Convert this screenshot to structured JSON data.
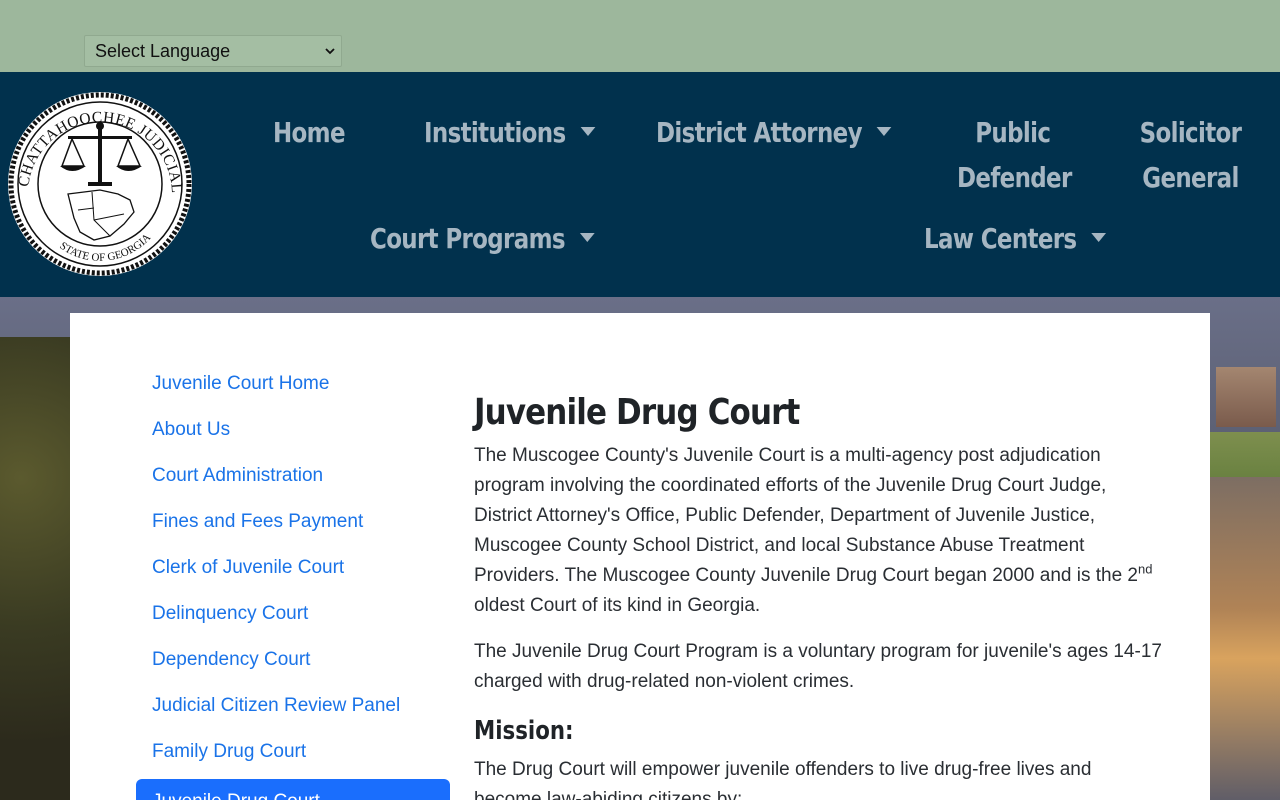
{
  "language": {
    "selected": "Select Language"
  },
  "nav": {
    "items": [
      {
        "label": "Home"
      },
      {
        "label": "Institutions"
      },
      {
        "label": "District Attorney"
      },
      {
        "label": "Public Defender"
      },
      {
        "label": "Solicitor General"
      },
      {
        "label": "Court Programs"
      },
      {
        "label": "Law Centers"
      }
    ]
  },
  "seal": {
    "outer_text": "CHATTAHOOCHEE JUDICIAL CIRCUIT",
    "inner_text": "STATE OF GEORGIA"
  },
  "sidebar": {
    "items": [
      {
        "label": "Juvenile Court Home"
      },
      {
        "label": "About Us"
      },
      {
        "label": "Court Administration"
      },
      {
        "label": "Fines and Fees Payment"
      },
      {
        "label": "Clerk of Juvenile Court"
      },
      {
        "label": "Delinquency Court"
      },
      {
        "label": "Dependency Court"
      },
      {
        "label": "Judicial Citizen Review Panel"
      },
      {
        "label": "Family Drug Court"
      },
      {
        "label": "Juvenile Drug Court"
      }
    ]
  },
  "main": {
    "title": "Juvenile Drug Court",
    "para1_a": "The Muscogee County's Juvenile Court is a multi-agency post adjudication program involving the coordinated efforts of the Juvenile Drug Court Judge, District Attorney's Office, Public Defender, Department of Juvenile Justice, Muscogee County School District, and local Substance Abuse Treatment Providers. The Muscogee County Juvenile Drug Court began 2000 and is the 2",
    "para1_sup": "nd",
    "para1_b": " oldest Court of its kind in Georgia.",
    "para2": "The Juvenile Drug Court Program is a voluntary program for juvenile's ages 14-17 charged with drug-related non-violent crimes.",
    "mission_heading": "Mission:",
    "para3": "The Drug Court will empower juvenile offenders to live drug-free lives and become law-abiding citizens by:"
  },
  "colors": {
    "topbar": "#9db79c",
    "navbar": "#01314d",
    "nav_text": "#a6b6c2",
    "link": "#1a73e8",
    "active": "#1a6efd"
  }
}
